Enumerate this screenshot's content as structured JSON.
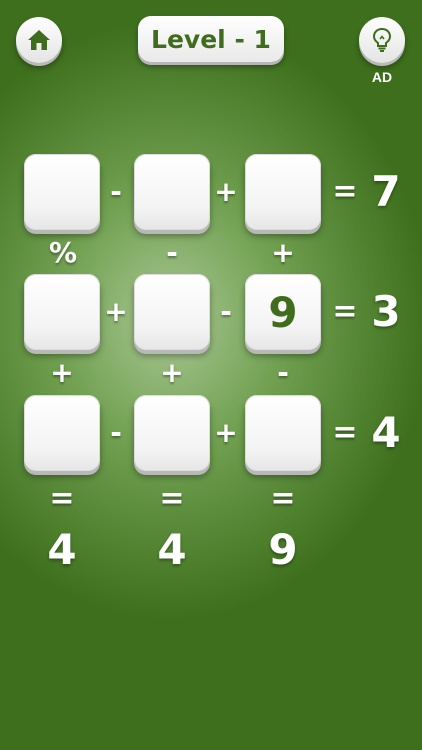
{
  "header": {
    "level_label": "Level - 1",
    "hint_label": "AD"
  },
  "grid": {
    "rows": [
      {
        "cells": [
          "",
          "",
          ""
        ],
        "ops": [
          "-",
          "+"
        ],
        "equals": "=",
        "result": "7"
      },
      {
        "cells": [
          "",
          "",
          "9"
        ],
        "ops": [
          "+",
          "-"
        ],
        "equals": "=",
        "result": "3"
      },
      {
        "cells": [
          "",
          "",
          ""
        ],
        "ops": [
          "-",
          "+"
        ],
        "equals": "=",
        "result": "4"
      }
    ],
    "vertical_ops": [
      [
        "%",
        "-",
        "+"
      ],
      [
        "+",
        "+",
        "-"
      ]
    ],
    "bottom_equals": [
      "=",
      "=",
      "="
    ],
    "column_results": [
      "4",
      "4",
      "9"
    ]
  },
  "icons": {
    "home": "home-icon",
    "hint": "lightbulb-icon"
  },
  "colors": {
    "accent": "#3f6d1d",
    "background_center": "#a9c793",
    "background_edge": "#3d6f1c"
  }
}
